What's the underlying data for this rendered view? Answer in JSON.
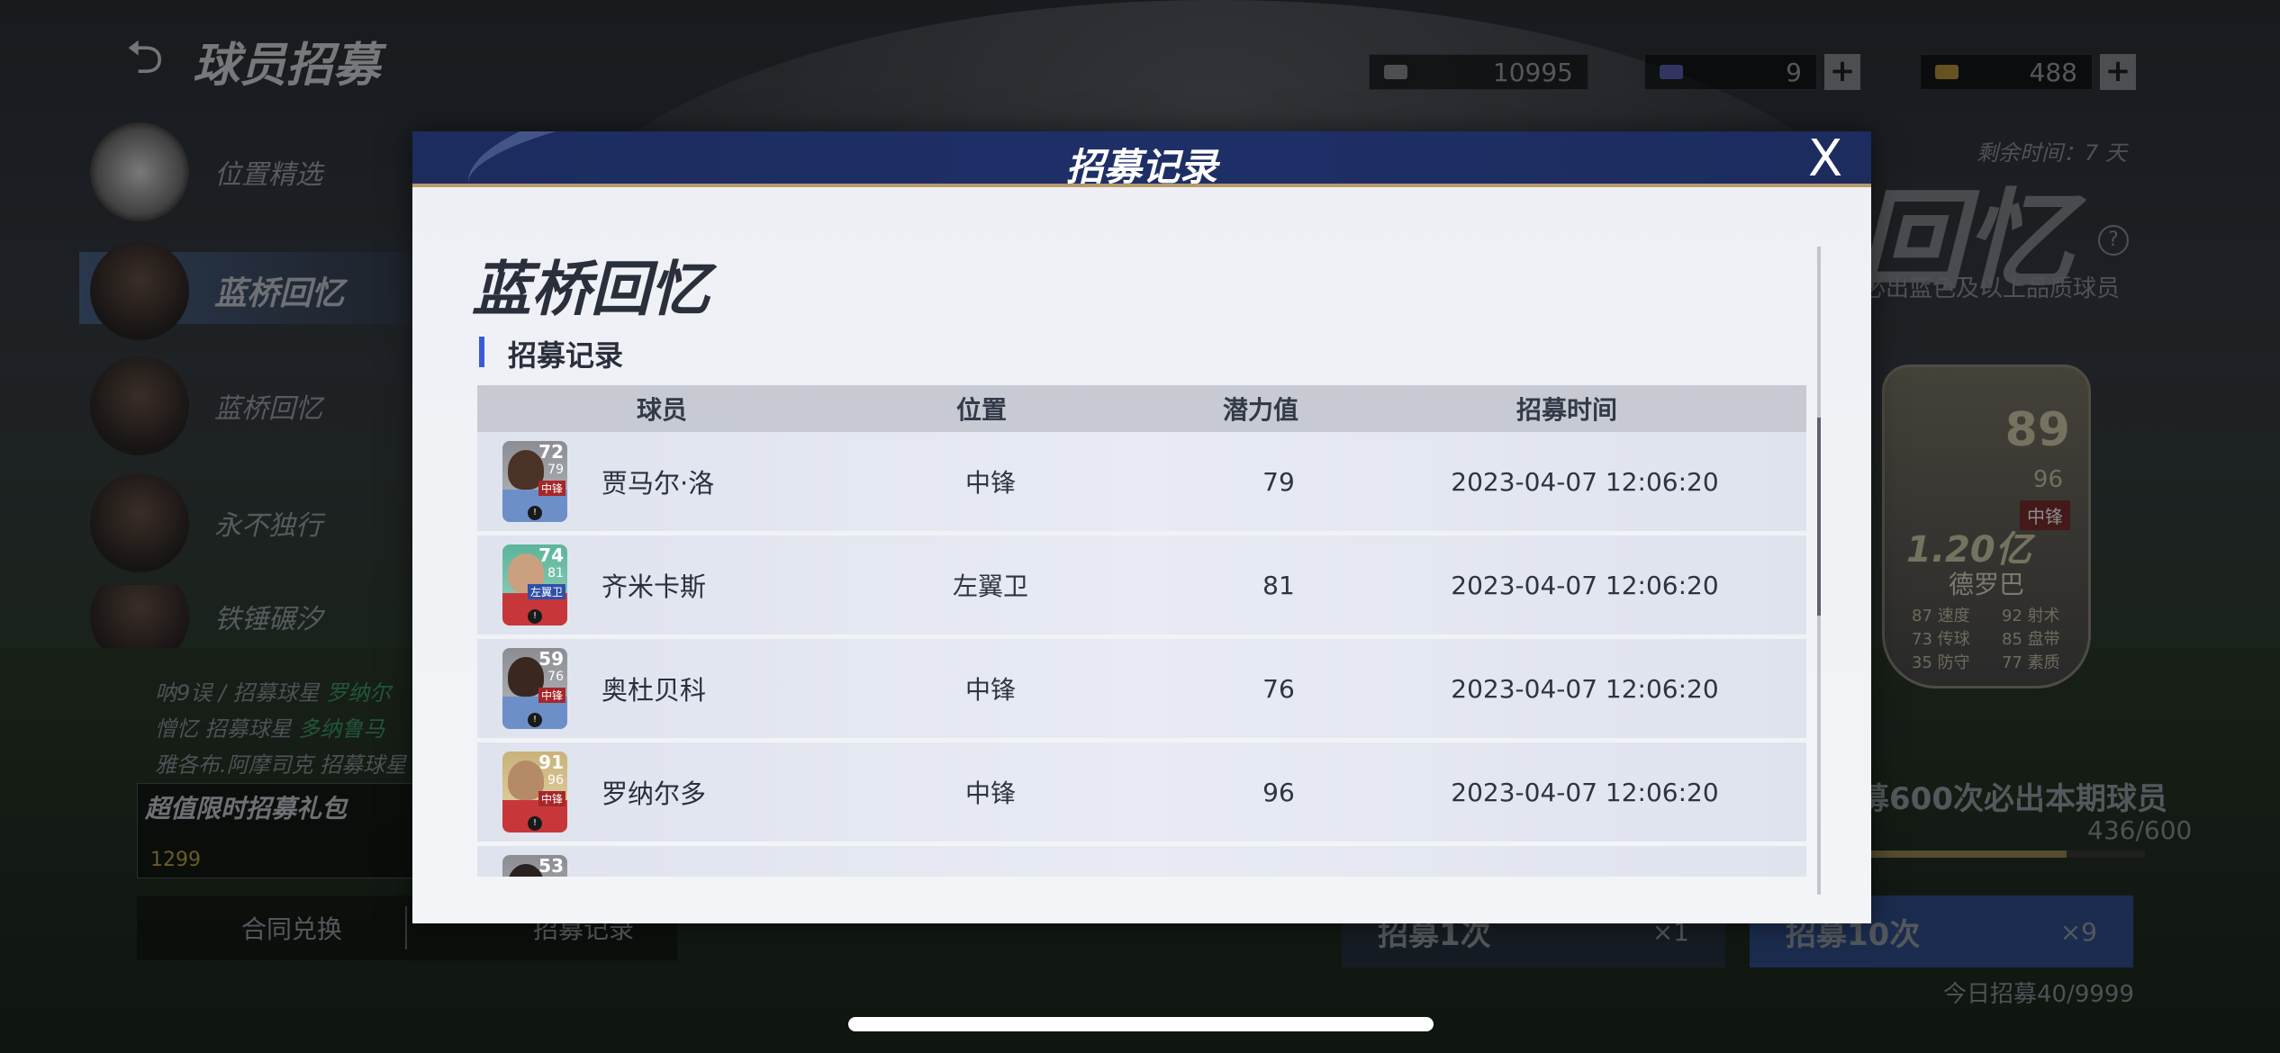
{
  "header": {
    "title": "球员招募",
    "currencies": [
      {
        "icon": "coin-icon",
        "value": "10995"
      },
      {
        "icon": "ticket-icon",
        "value": "9"
      },
      {
        "icon": "gold-icon",
        "value": "488"
      }
    ]
  },
  "sidebar": {
    "items": [
      {
        "label": "位置精选"
      },
      {
        "label": "蓝桥回忆"
      },
      {
        "label": "蓝桥回忆"
      },
      {
        "label": "永不独行"
      },
      {
        "label": "铁锤碾汐"
      }
    ]
  },
  "ticker": [
    {
      "prefix": "呐9误 / 招募球星",
      "name": "罗纳尔"
    },
    {
      "prefix": "憎忆 招募球星",
      "name": "多纳鲁马"
    },
    {
      "prefix": "雅各布.阿摩司克 招募球星",
      "name": ""
    }
  ],
  "gift": {
    "title": "超值限时招募礼包",
    "price": "1299"
  },
  "bottom_nav": {
    "exchange": "合同兑换",
    "records": "招募记录"
  },
  "event": {
    "remaining": "剩余时间：7 天",
    "title": "回忆",
    "subtitle": "必出蓝色及以上品质球员",
    "question": "?",
    "featured": {
      "rating": "89",
      "potential": "96",
      "position": "中锋",
      "value": "1.20亿",
      "name": "德罗巴",
      "stats": [
        "87 速度",
        "92 射术",
        "73 传球",
        "85 盘带",
        "35 防守",
        "77 素质"
      ]
    },
    "progress_title": "募600次必出本期球员",
    "progress_count": "436/600",
    "progress_fraction": 0.727,
    "recruit_once": {
      "label": "招募1次",
      "cost": "×1"
    },
    "recruit_ten": {
      "label": "招募10次",
      "cost": "×9"
    },
    "daily": "今日招募40/9999"
  },
  "modal": {
    "title": "招募记录",
    "close": "X",
    "event_name": "蓝桥回忆",
    "section": "招募记录",
    "columns": [
      "球员",
      "位置",
      "潜力值",
      "招募时间"
    ],
    "rows": [
      {
        "name": "贾马尔·洛",
        "rating": "72",
        "potential": "79",
        "card_pos": "中锋",
        "position": "中锋",
        "pot": "79",
        "time": "2023-04-07 12:06:20"
      },
      {
        "name": "齐米卡斯",
        "rating": "74",
        "potential": "81",
        "card_pos": "左翼卫",
        "position": "左翼卫",
        "pot": "81",
        "time": "2023-04-07 12:06:20"
      },
      {
        "name": "奥杜贝科",
        "rating": "59",
        "potential": "76",
        "card_pos": "中锋",
        "position": "中锋",
        "pot": "76",
        "time": "2023-04-07 12:06:20"
      },
      {
        "name": "罗纳尔多",
        "rating": "91",
        "potential": "96",
        "card_pos": "中锋",
        "position": "中锋",
        "pot": "96",
        "time": "2023-04-07 12:06:20"
      },
      {
        "name": "",
        "rating": "53",
        "potential": "",
        "card_pos": "",
        "position": "",
        "pot": "",
        "time": ""
      }
    ]
  }
}
